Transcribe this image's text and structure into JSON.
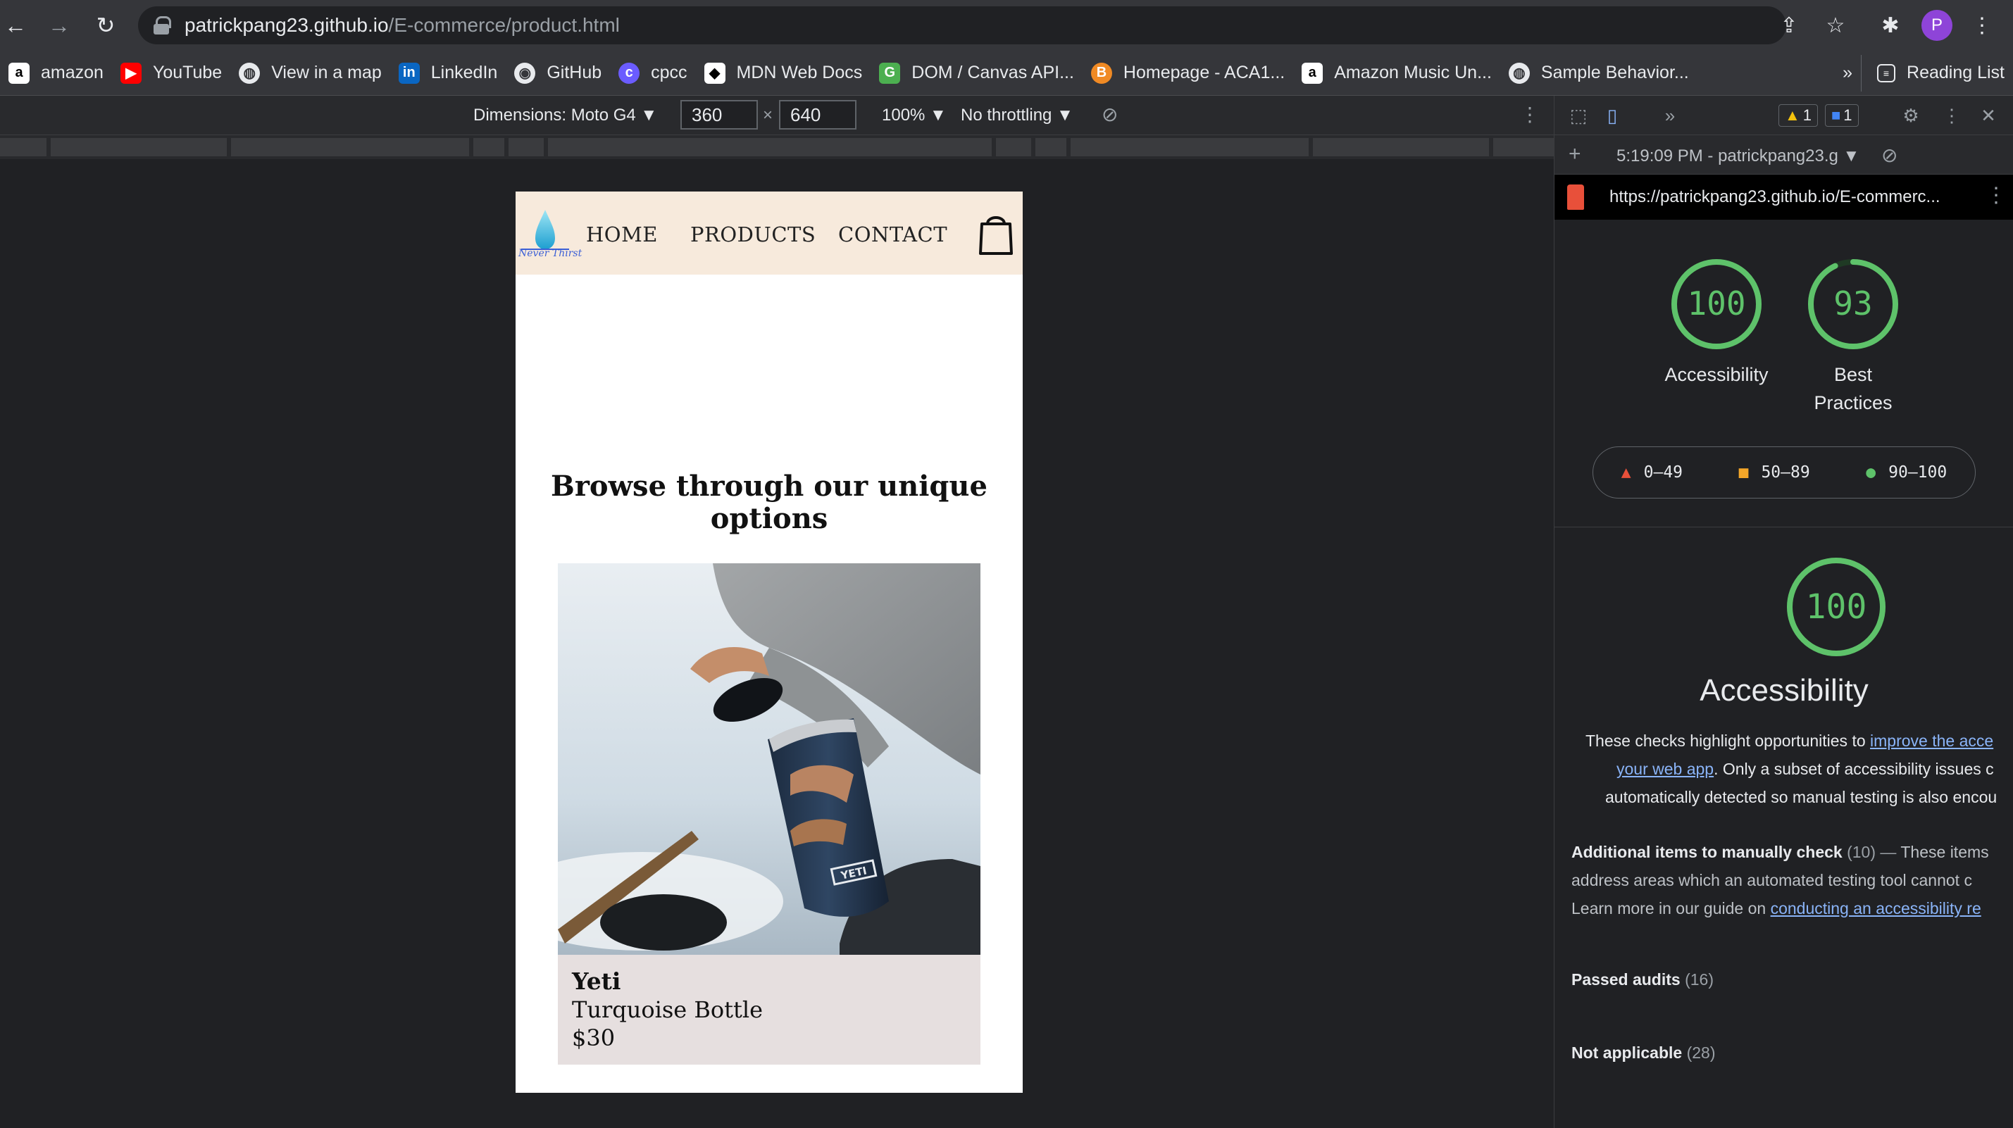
{
  "browser": {
    "url_host": "patrickpang23.github.io",
    "url_path": "/E-commerce/product.html",
    "profile_initial": "P",
    "icons": [
      "back-icon",
      "forward-icon",
      "reload-icon",
      "lock-icon",
      "share-icon",
      "star-icon",
      "extensions-icon",
      "menu-icon"
    ]
  },
  "bookmarks": {
    "items": [
      {
        "label": "amazon",
        "icon": "amazon-icon",
        "color": "#ffffff"
      },
      {
        "label": "YouTube",
        "icon": "youtube-icon",
        "color": "#ff0000"
      },
      {
        "label": "View in a map",
        "icon": "globe-icon",
        "color": "#e8eaed"
      },
      {
        "label": "LinkedIn",
        "icon": "linkedin-icon",
        "color": "#0a66c2"
      },
      {
        "label": "GitHub",
        "icon": "github-icon",
        "color": "#e8eaed"
      },
      {
        "label": "cpcc",
        "icon": "cpcc-icon",
        "color": "#6b5cff"
      },
      {
        "label": "MDN Web Docs",
        "icon": "mdn-icon",
        "color": "#ffffff"
      },
      {
        "label": "DOM / Canvas API...",
        "icon": "canvas-icon",
        "color": "#4caf50"
      },
      {
        "label": "Homepage - ACA1...",
        "icon": "aca-icon",
        "color": "#f08a24"
      },
      {
        "label": "Amazon Music Un...",
        "icon": "amazon-icon",
        "color": "#ffffff"
      },
      {
        "label": "Sample Behavior...",
        "icon": "globe-icon",
        "color": "#e8eaed"
      }
    ],
    "overflow": "»",
    "reading_list": "Reading List"
  },
  "device_toolbar": {
    "dimensions_label": "Dimensions: Moto G4 ▼",
    "width": "360",
    "times": "×",
    "height": "640",
    "zoom": "100% ▼",
    "throttling": "No throttling ▼"
  },
  "site": {
    "logo_text": "Never Thirst",
    "nav": [
      "HOME",
      "PRODUCTS",
      "CONTACT"
    ],
    "heading": "Browse through our unique options",
    "product": {
      "brand": "Yeti",
      "name": "Turquoise Bottle",
      "price": "$30",
      "image_brand_mark": "YETI"
    },
    "colors": {
      "header_bg": "#f7eadc",
      "card_bg": "#e6dfdf"
    }
  },
  "devtools": {
    "warnings": "1",
    "messages": "1",
    "session": "5:19:09 PM - patrickpang23.g ▼",
    "report_url": "https://patrickpang23.github.io/E-commerc...",
    "scores": [
      {
        "value": "100",
        "label": "Accessibility",
        "fraction": 1.0
      },
      {
        "value": "93",
        "label": "Best Practices",
        "fraction": 0.93
      }
    ],
    "legend": [
      "0–49",
      "50–89",
      "90–100"
    ],
    "section": {
      "score": "100",
      "fraction": 1.0,
      "title": "Accessibility",
      "desc_1": "These checks highlight opportunities to ",
      "desc_link_1": "improve the acce",
      "desc_link_2": "your web app",
      "desc_2": ". Only a subset of accessibility issues c",
      "desc_3": "automatically detected so manual testing is also encou",
      "manual_title": "Additional items to manually check",
      "manual_count": "(10)",
      "manual_text_1": "These items",
      "manual_text_2": "address areas which an automated testing tool cannot c",
      "manual_text_3": "Learn more in our guide on ",
      "manual_link": "conducting an accessibility re",
      "passed": "Passed audits",
      "passed_count": "(16)",
      "na": "Not applicable",
      "na_count": "(28)"
    },
    "colors": {
      "pass": "#5ec26a",
      "average": "#f4a629",
      "fail": "#e8503a"
    }
  }
}
